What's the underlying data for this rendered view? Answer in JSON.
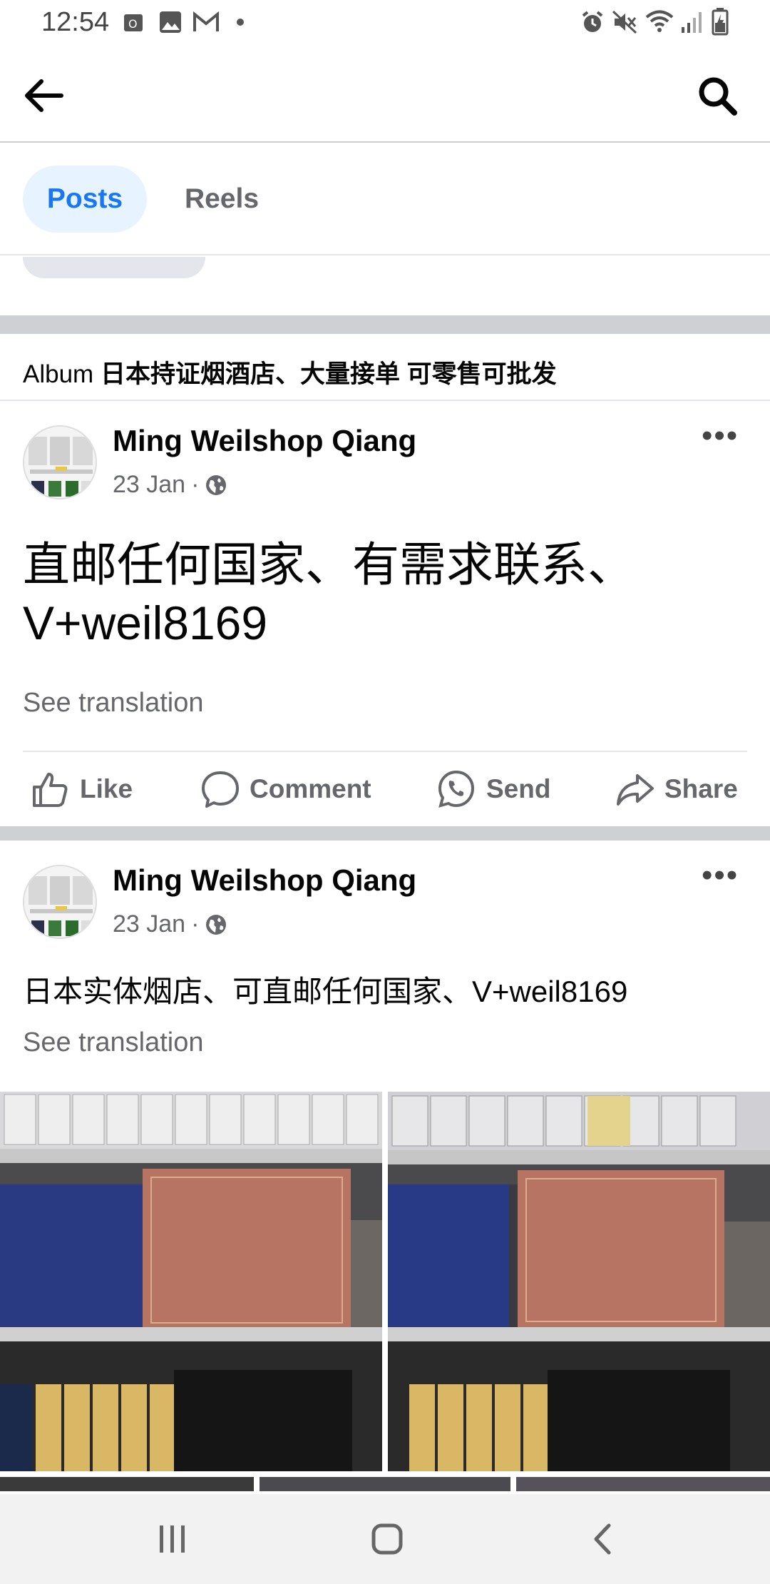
{
  "status_bar": {
    "time": "12:54",
    "left_icons": [
      "outlook-icon",
      "gallery-icon",
      "gmail-icon",
      "dot-icon"
    ],
    "right_icons": [
      "alarm-icon",
      "mute-icon",
      "wifi-icon",
      "signal-icon",
      "battery-icon"
    ]
  },
  "app_bar": {
    "back_icon": "arrow-left-icon",
    "search_icon": "search-icon"
  },
  "tabs": [
    {
      "label": "Posts",
      "active": true
    },
    {
      "label": "Reels",
      "active": false
    }
  ],
  "album": {
    "prefix": "Album",
    "title": "日本持证烟酒店、大量接单 可零售可批发"
  },
  "posts": [
    {
      "author": "Ming Weilshop Qiang",
      "date": "23 Jan",
      "separator": "·",
      "text_line1": "直邮任何国家、有需求联系、",
      "text_line2": "V+weil8169",
      "see_translation": "See translation",
      "actions": [
        "Like",
        "Comment",
        "Send",
        "Share"
      ]
    },
    {
      "author": "Ming Weilshop Qiang",
      "date": "23 Jan",
      "separator": "·",
      "text": "日本实体烟店、可直邮任何国家、V+weil8169",
      "see_translation": "See translation"
    }
  ],
  "colors": {
    "accent": "#1877f2",
    "tab_active_bg": "#e7f3ff",
    "muted_text": "#65676b",
    "separator": "#ced0d4"
  }
}
